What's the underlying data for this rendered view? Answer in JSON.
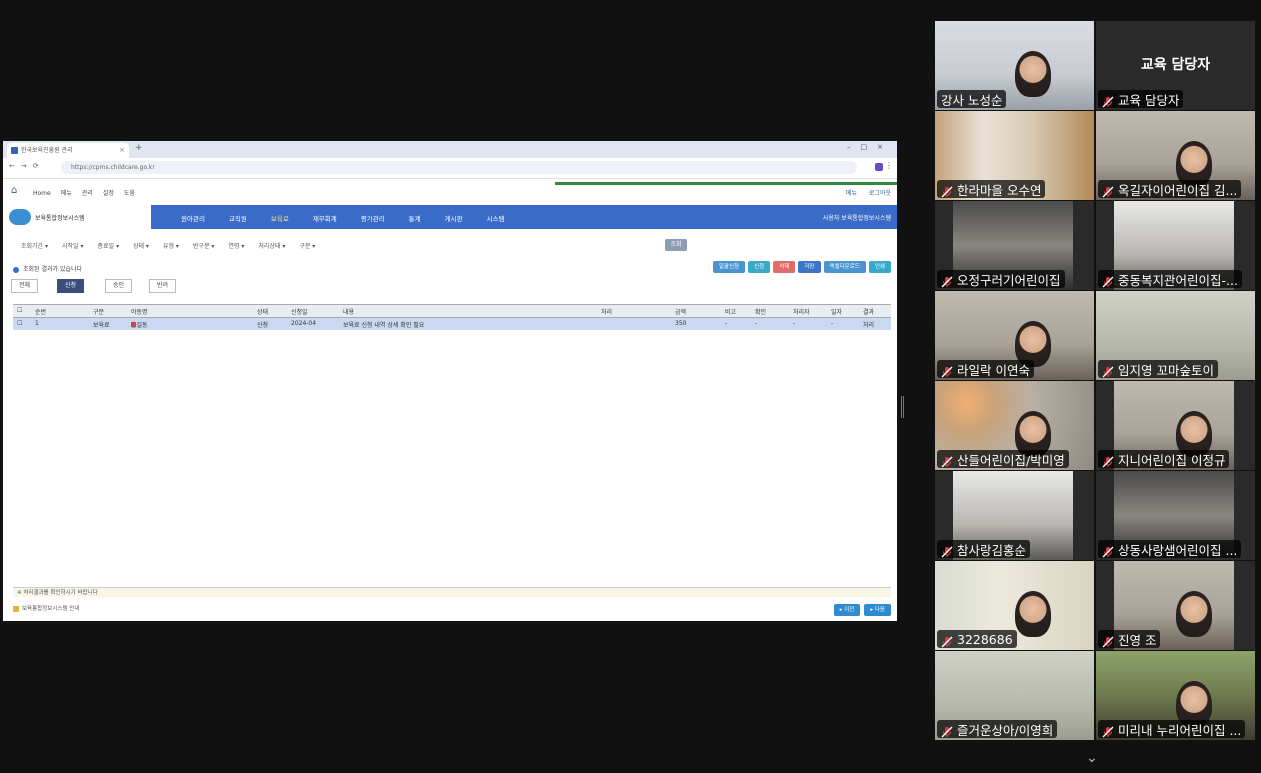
{
  "shared_screen": {
    "tabs": [
      {
        "label": "한국보육진흥원 관리"
      }
    ],
    "url": "https://cpms.childcare.go.kr",
    "fav_links": [
      "Home",
      "메뉴",
      "관리",
      "설정",
      "도움"
    ],
    "util_links": [
      "메뉴",
      "로그아웃"
    ],
    "app_title": "보육통합정보시스템",
    "menus": [
      "원아관리",
      "교직원",
      "보육료",
      "재무회계",
      "평가관리",
      "통계",
      "게시판",
      "시스템"
    ],
    "active_menu_index": 2,
    "user_info": "사용자 보육통합정보시스템",
    "filter_labels": [
      "조회기간",
      "시작일",
      "종료일",
      "상태",
      "유형",
      "반구분",
      "연령",
      "처리상태",
      "구분"
    ],
    "search_label": "조회",
    "info_text": "조회된 결과가 있습니다",
    "action_buttons": [
      {
        "label": "일괄신청",
        "color": "#4a95d0"
      },
      {
        "label": "신청",
        "color": "#3aa8c8"
      },
      {
        "label": "삭제",
        "color": "#e26a6a"
      },
      {
        "label": "저장",
        "color": "#3a75c8"
      },
      {
        "label": "엑셀다운로드",
        "color": "#4a95d0"
      },
      {
        "label": "인쇄",
        "color": "#3aa8c8"
      }
    ],
    "sub_tabs": [
      "전체",
      "신청",
      "승인",
      "반려"
    ],
    "active_sub_tab_index": 1,
    "grid_headers": [
      "순번",
      "구분",
      "아동명",
      "상태",
      "신청일",
      "내용",
      "처리",
      "금액",
      "비고",
      "확인",
      "처리자",
      "일자",
      "결과"
    ],
    "grid_rows": [
      [
        "1",
        "보육료",
        "홍길동",
        "신청",
        "2024-04",
        "보육료 신청 내역 상세 확인 필요",
        "",
        "350",
        "-",
        "-",
        "-",
        "-",
        "처리"
      ]
    ],
    "status_text": "※ 처리결과를 확인하시기 바랍니다",
    "footer_text": "보육통합정보시스템 안내",
    "footer_buttons": [
      "이전",
      "다음"
    ]
  },
  "participants": [
    {
      "name": "강사 노성순",
      "muted": false,
      "active": true,
      "video": true,
      "scene": "office"
    },
    {
      "name": "교육 담당자",
      "muted": true,
      "active": false,
      "video": false,
      "display": "교육 담당자"
    },
    {
      "name": "한라마을 오수연",
      "muted": true,
      "video": true,
      "scene": "cabinet"
    },
    {
      "name": "옥길자이어린이집 김...",
      "muted": true,
      "video": true,
      "scene": "room"
    },
    {
      "name": "오정구러기어린이집",
      "muted": true,
      "video": true,
      "scene": "hall"
    },
    {
      "name": "중동복지관어린이집-...",
      "muted": true,
      "video": true,
      "scene": "ceiling"
    },
    {
      "name": "라일락 이연숙",
      "muted": true,
      "video": true,
      "scene": "room"
    },
    {
      "name": "임지영 꼬마숲토이",
      "muted": true,
      "video": true,
      "scene": "wall"
    },
    {
      "name": "산들어린이집/박미영",
      "muted": true,
      "video": true,
      "scene": "lamp"
    },
    {
      "name": "지니어린이집 이정규",
      "muted": true,
      "video": true,
      "scene": "room"
    },
    {
      "name": "참사랑김홍순",
      "muted": true,
      "video": true,
      "scene": "ceiling"
    },
    {
      "name": "상동사랑샘어린이집 ...",
      "muted": true,
      "video": true,
      "scene": "hall"
    },
    {
      "name": "3228686",
      "muted": true,
      "video": true,
      "scene": "tree"
    },
    {
      "name": "진영 조",
      "muted": true,
      "video": true,
      "scene": "room"
    },
    {
      "name": "즐거운상아/이영희",
      "muted": true,
      "video": true,
      "scene": "wall"
    },
    {
      "name": "미리내 누리어린이집 ...",
      "muted": true,
      "video": true,
      "scene": "plants"
    }
  ],
  "colors": {
    "background": "#111111",
    "active_speaker": "#23d18b",
    "mute": "#e0393e"
  }
}
